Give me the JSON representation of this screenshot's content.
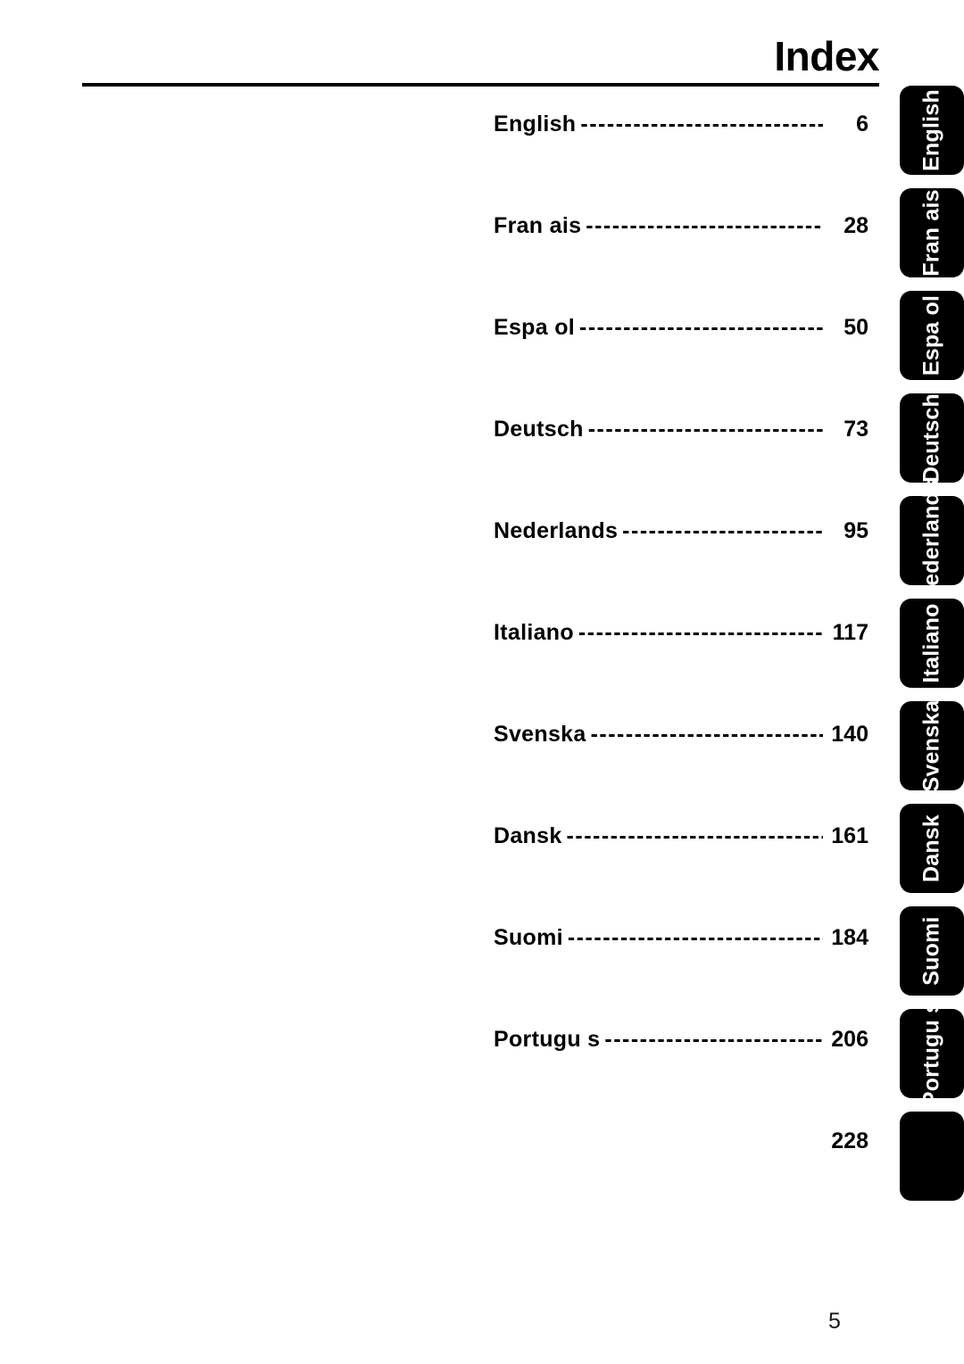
{
  "page": {
    "title": "Index",
    "page_number": "5"
  },
  "index": {
    "entries": [
      {
        "label": "English",
        "page": "6",
        "tab": "English"
      },
      {
        "label": "Fran ais",
        "page": "28",
        "tab": "Fran ais"
      },
      {
        "label": "Espa ol",
        "page": "50",
        "tab": "Espa ol"
      },
      {
        "label": "Deutsch",
        "page": "73",
        "tab": "Deutsch"
      },
      {
        "label": "Nederlands",
        "page": "95",
        "tab": "Nederlands"
      },
      {
        "label": "Italiano",
        "page": "117",
        "tab": "Italiano"
      },
      {
        "label": "Svenska",
        "page": "140",
        "tab": "Svenska"
      },
      {
        "label": "Dansk",
        "page": "161",
        "tab": "Dansk"
      },
      {
        "label": "Suomi",
        "page": "184",
        "tab": "Suomi"
      },
      {
        "label": "Portugu s",
        "page": "206",
        "tab": "Portugu s"
      },
      {
        "label": "",
        "page": "228",
        "tab": ""
      }
    ]
  },
  "colors": {
    "text": "#000000",
    "tab_background": "#000000",
    "tab_text": "#ffffff",
    "page_background": "#ffffff"
  }
}
